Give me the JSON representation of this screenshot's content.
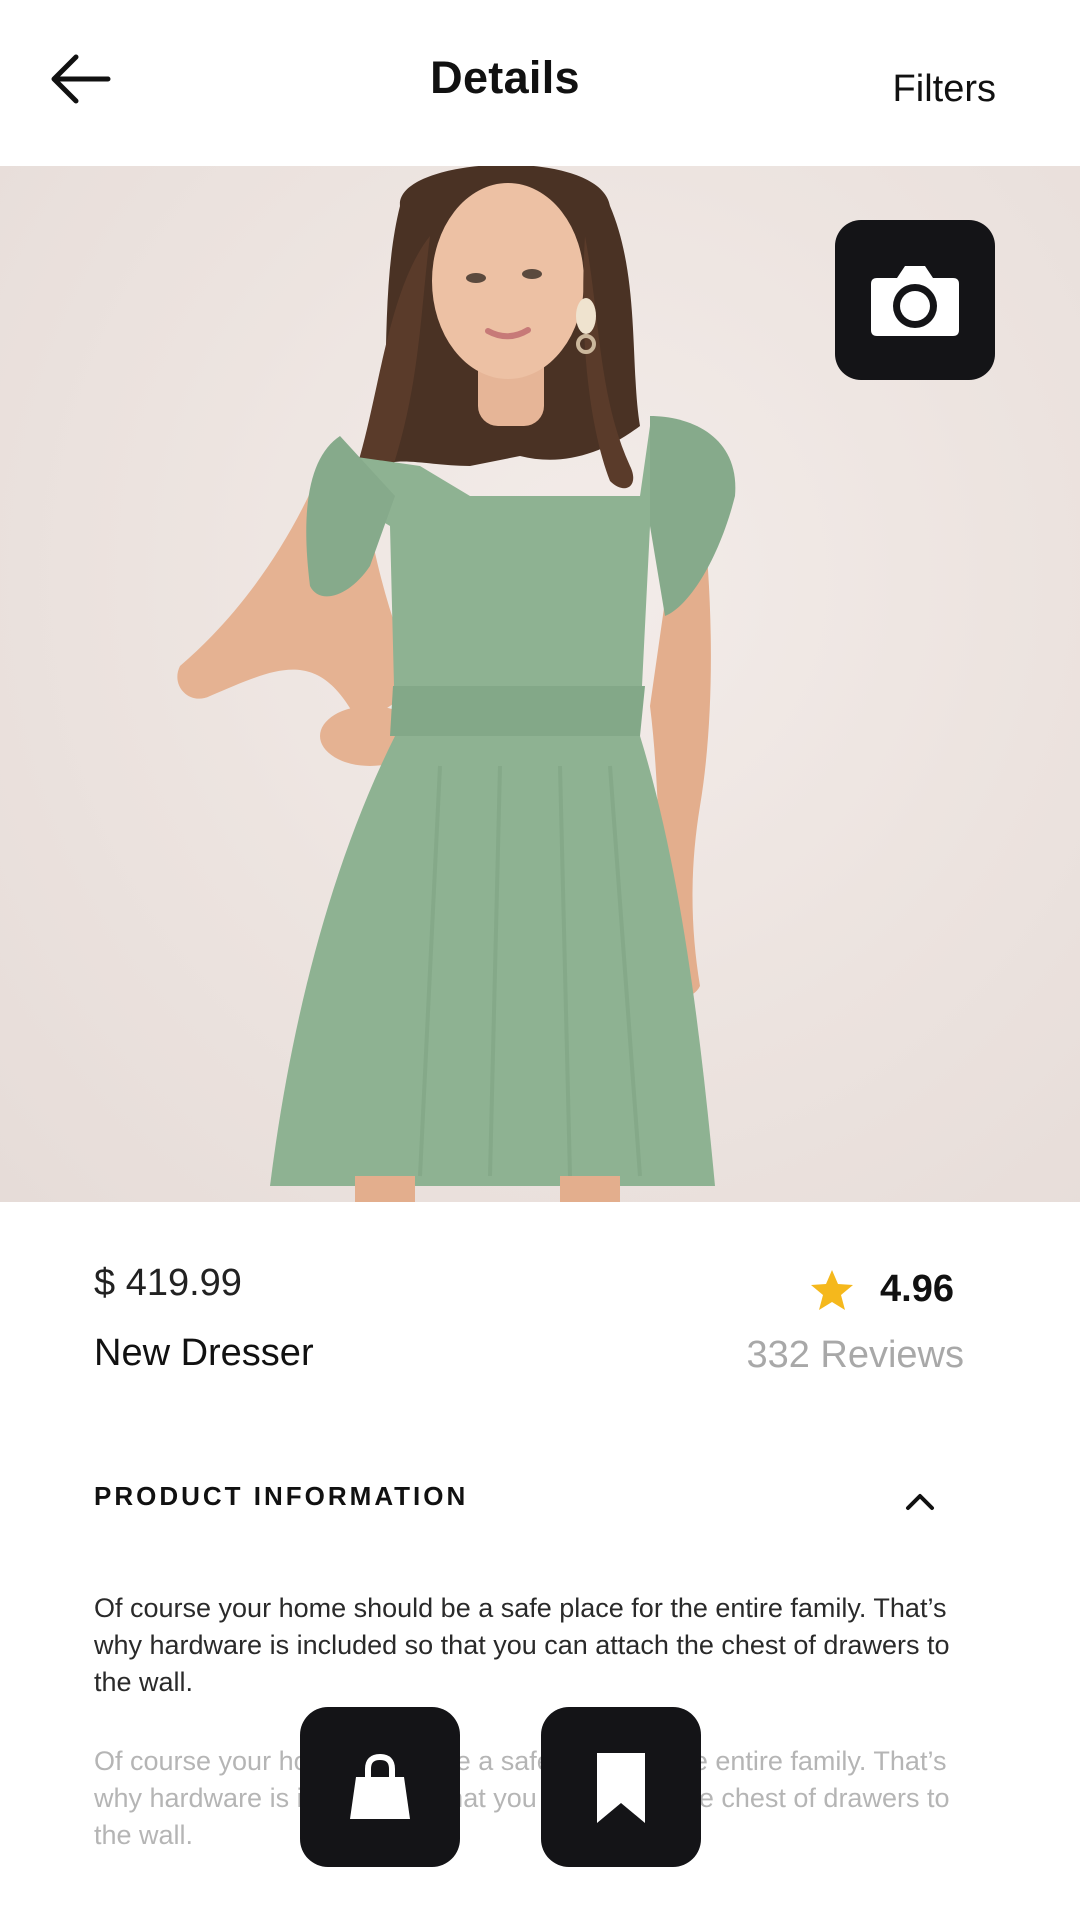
{
  "header": {
    "title": "Details",
    "back_icon": "arrow-left-icon",
    "filters_label": "Filters"
  },
  "hero": {
    "image_alt": "woman in sage green ruffle-sleeve dress",
    "camera_icon": "camera-icon"
  },
  "product": {
    "price": "$ 419.99",
    "name": "New Dresser",
    "rating": "4.96",
    "reviews": "332 Reviews",
    "star_color": "#f5b81c"
  },
  "info_section": {
    "title": "PRODUCT INFORMATION",
    "toggle_icon": "chevron-up-icon",
    "paragraphs": [
      "Of course your home should be a safe place for the entire family. That’s why hardware is included so that you can attach the chest of drawers to the wall.",
      "Of course your home should be a safe place for the entire family. That’s why hardware is included so that you can attach the chest of drawers to the wall."
    ]
  },
  "actions": {
    "bag_icon": "shopping-bag-icon",
    "bookmark_icon": "bookmark-icon"
  },
  "colors": {
    "dark_button": "#141417",
    "dress": "#8eb292",
    "muted_text": "#a8a8a8"
  }
}
